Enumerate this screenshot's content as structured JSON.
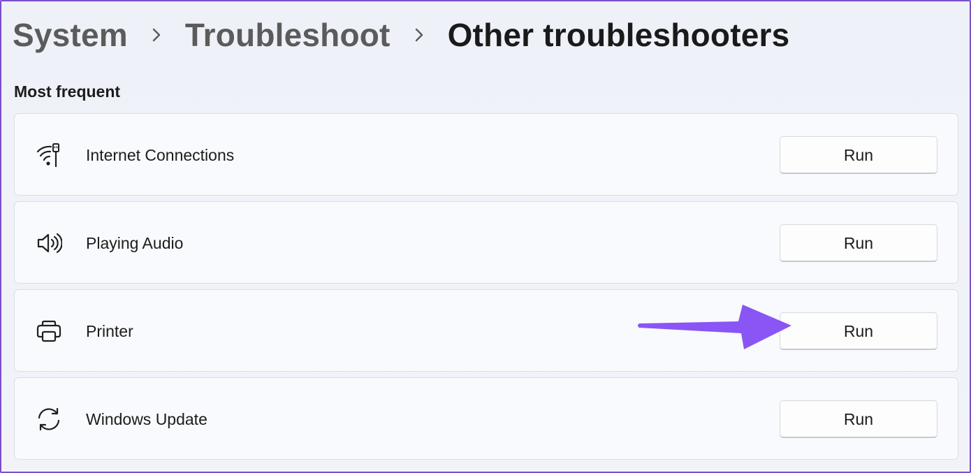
{
  "breadcrumb": {
    "items": [
      "System",
      "Troubleshoot",
      "Other troubleshooters"
    ]
  },
  "section": {
    "title": "Most frequent"
  },
  "troubleshooters": [
    {
      "label": "Internet Connections",
      "icon": "wifi-ethernet-icon",
      "button": "Run"
    },
    {
      "label": "Playing Audio",
      "icon": "speaker-icon",
      "button": "Run"
    },
    {
      "label": "Printer",
      "icon": "printer-icon",
      "button": "Run"
    },
    {
      "label": "Windows Update",
      "icon": "sync-icon",
      "button": "Run"
    }
  ],
  "annotation": {
    "arrow_color": "#8a55f5",
    "points_to": "Printer Run button"
  },
  "colors": {
    "background": "#eef1f8",
    "card": "#f9fafd",
    "frame_border": "#7a4fc9"
  }
}
